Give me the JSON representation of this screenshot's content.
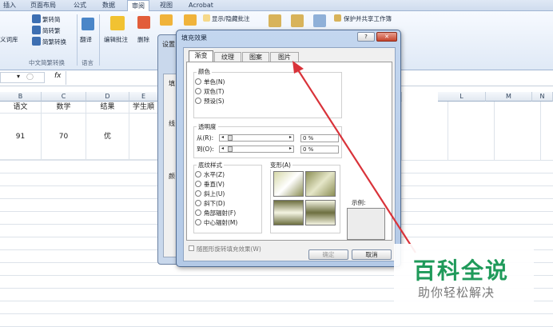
{
  "ribbon": {
    "tabs": [
      "插入",
      "页面布局",
      "公式",
      "数据",
      "审阅",
      "视图",
      "Acrobat"
    ],
    "active_tab": "审阅",
    "buttons": {
      "custom_dict": "义词库",
      "trad_to_simp": "繁转简",
      "simp_to_trad": "简转繁",
      "convert": "简繁转换",
      "translate": "翻译",
      "edit_comment": "编辑批注",
      "delete": "删除",
      "show_hide_comment": "显示/隐藏批注",
      "protect_share": "保护并共享工作簿",
      "protect_label": "保护"
    },
    "group_labels": {
      "chinese": "中文简繁转换",
      "language": "语言"
    }
  },
  "formula_bar": {
    "fx": "fx"
  },
  "sheet": {
    "col_headers": [
      "B",
      "C",
      "D",
      "E",
      "L",
      "M",
      "N"
    ],
    "headers": [
      "语文",
      "数学",
      "结果",
      "学生順"
    ],
    "row": [
      "91",
      "70",
      "优"
    ]
  },
  "back_dialog": {
    "title_fragment": "设置",
    "side_labels": [
      "填",
      "线",
      "颜"
    ]
  },
  "dialog": {
    "title": "填充效果",
    "help": "?",
    "close": "✕",
    "tabs": [
      "渐变",
      "纹理",
      "图案",
      "图片"
    ],
    "active_tab": "渐变",
    "color_group": "颜色",
    "color_options": [
      "单色(N)",
      "双色(T)",
      "预设(S)"
    ],
    "transparency_group": "透明度",
    "from_label": "从(R):",
    "to_label": "到(O):",
    "from_value": "0 %",
    "to_value": "0 %",
    "style_group": "底纹样式",
    "style_options": [
      "水平(Z)",
      "垂直(V)",
      "斜上(U)",
      "斜下(D)",
      "角部辐射(F)",
      "中心辐射(M)"
    ],
    "variants_label": "变形(A)",
    "sample_label": "示例:",
    "rotate_checkbox": "随图形旋转填充效果(W)",
    "ok": "确定",
    "cancel": "取消"
  },
  "watermark": {
    "title": "百科全说",
    "subtitle": "助你轻松解决"
  },
  "colors": {
    "arrow": "#d9333a",
    "watermark_green": "#1f9a5a"
  }
}
